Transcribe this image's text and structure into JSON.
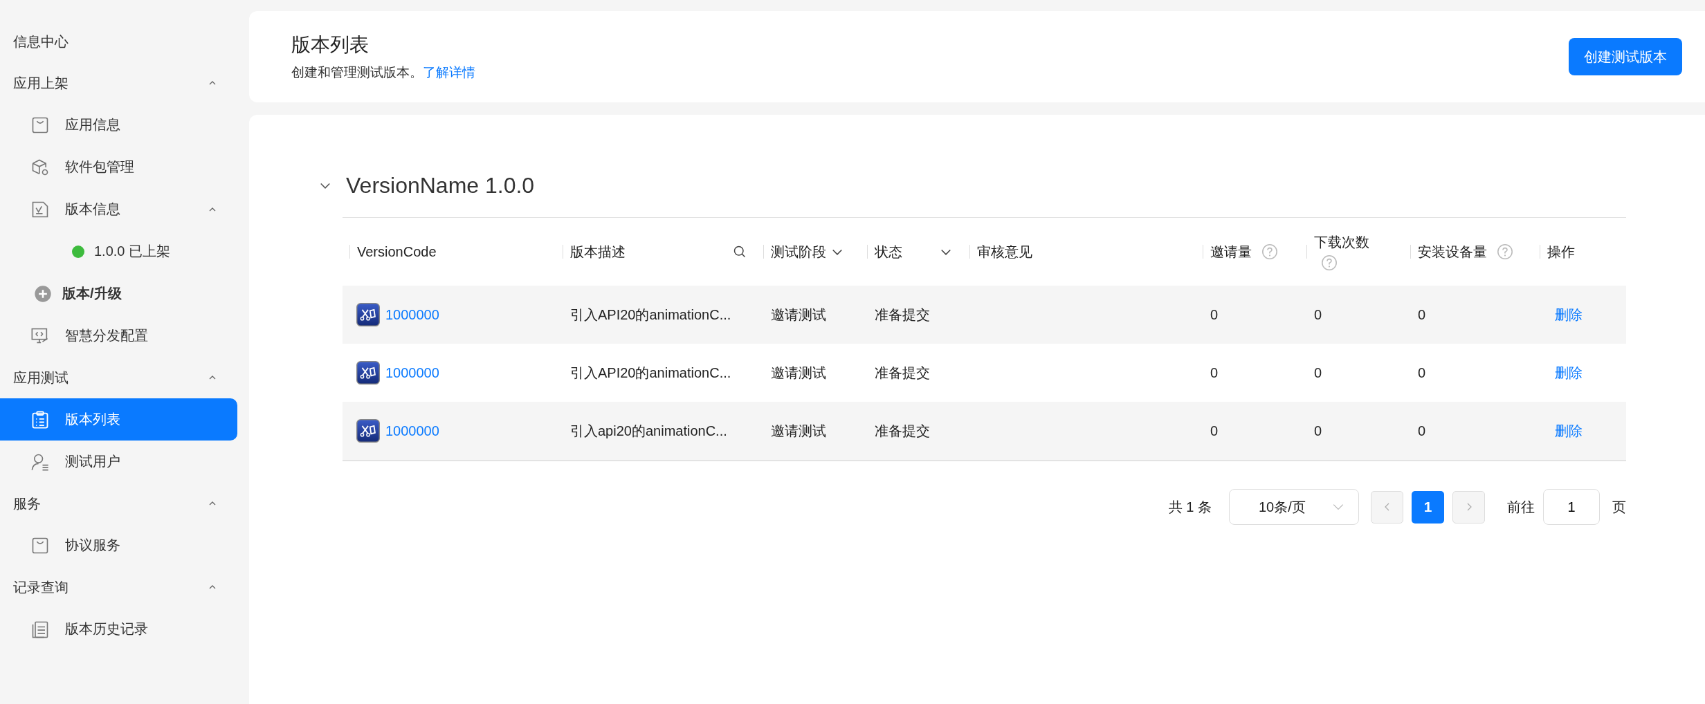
{
  "sidebar": {
    "groups": [
      {
        "label": "信息中心"
      },
      {
        "label": "应用上架",
        "expanded": true,
        "items": [
          {
            "label": "应用信息",
            "kind": "link",
            "selected": false
          },
          {
            "label": "软件包管理",
            "kind": "link",
            "selected": false
          },
          {
            "label": "版本信息",
            "kind": "link",
            "selected": false,
            "expanded": true,
            "children": [
              {
                "label": "1.0.0 已上架",
                "color": "#3dbb3d"
              }
            ]
          },
          {
            "label": "版本/升级",
            "kind": "action",
            "selected": false
          },
          {
            "label": "智慧分发配置",
            "kind": "link",
            "selected": false
          }
        ]
      },
      {
        "label": "应用测试",
        "expanded": true,
        "items": [
          {
            "label": "版本列表",
            "kind": "link",
            "selected": true
          },
          {
            "label": "测试用户",
            "kind": "link",
            "selected": false
          }
        ]
      },
      {
        "label": "服务",
        "expanded": true,
        "items": [
          {
            "label": "协议服务",
            "kind": "link",
            "selected": false
          }
        ]
      },
      {
        "label": "记录查询",
        "expanded": true,
        "items": [
          {
            "label": "版本历史记录",
            "kind": "link",
            "selected": false
          }
        ]
      }
    ]
  },
  "header": {
    "title": "版本列表",
    "description": "创建和管理测试版本。",
    "link": "了解详情",
    "button": "创建测试版本"
  },
  "section": {
    "title": "VersionName 1.0.0",
    "expanded": true
  },
  "table": {
    "columns": [
      {
        "label": "VersionCode",
        "kind": "plain"
      },
      {
        "label": "版本描述",
        "kind": "search"
      },
      {
        "label": "测试阶段",
        "kind": "filter"
      },
      {
        "label": "状态",
        "kind": "filter-wide"
      },
      {
        "label": "审核意见",
        "kind": "plain"
      },
      {
        "label": "邀请量",
        "kind": "help"
      },
      {
        "label": "下载次数",
        "kind": "help-wrap"
      },
      {
        "label": "安装设备量",
        "kind": "help"
      },
      {
        "label": "操作",
        "kind": "plain"
      }
    ],
    "rows": [
      {
        "version_code": "1000000",
        "description": "引入API20的animationC...",
        "stage": "邀请测试",
        "status": "准备提交",
        "invites": "0",
        "downloads": "0",
        "installs": "0",
        "action": "删除"
      },
      {
        "version_code": "1000000",
        "description": "引入API20的animationC...",
        "stage": "邀请测试",
        "status": "准备提交",
        "invites": "0",
        "downloads": "0",
        "installs": "0",
        "action": "删除"
      },
      {
        "version_code": "1000000",
        "description": "引入api20的animationC...",
        "stage": "邀请测试",
        "status": "准备提交",
        "invites": "0",
        "downloads": "0",
        "installs": "0",
        "action": "删除"
      }
    ]
  },
  "pagination": {
    "total": "共 1 条",
    "page_size": "10条/页",
    "prev_disabled": true,
    "next_disabled": true,
    "pages": [
      {
        "label": "1",
        "selected": true
      }
    ],
    "goto_label": "前往",
    "goto_value": "1",
    "page_suffix": "页"
  }
}
